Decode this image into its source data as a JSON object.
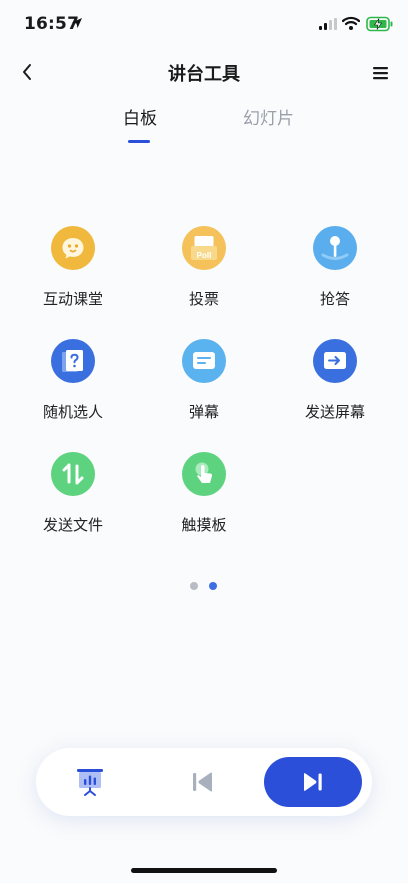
{
  "status_bar": {
    "time": "16:57"
  },
  "nav": {
    "title": "讲台工具"
  },
  "tabs": [
    {
      "label": "白板",
      "active": true
    },
    {
      "label": "幻灯片",
      "active": false
    }
  ],
  "tools": [
    {
      "label": "互动课堂",
      "icon": "chat-bubble-icon",
      "color": "#f0b93e"
    },
    {
      "label": "投票",
      "icon": "poll-icon",
      "icon_text": "Poll",
      "color": "#f4c15a"
    },
    {
      "label": "抢答",
      "icon": "joystick-icon",
      "color": "#5aaeee"
    },
    {
      "label": "随机选人",
      "icon": "random-card-icon",
      "color": "#3a6fe0"
    },
    {
      "label": "弹幕",
      "icon": "danmaku-icon",
      "color": "#5ab2ee"
    },
    {
      "label": "发送屏幕",
      "icon": "send-screen-icon",
      "color": "#3a6fe0"
    },
    {
      "label": "发送文件",
      "icon": "send-file-icon",
      "color": "#5dd27f"
    },
    {
      "label": "触摸板",
      "icon": "touchpad-icon",
      "color": "#5dd27f"
    }
  ],
  "pagination": {
    "total": 2,
    "current": 2
  },
  "colors": {
    "accent": "#2b4fd8",
    "tab_inactive": "#9aa0aa"
  }
}
